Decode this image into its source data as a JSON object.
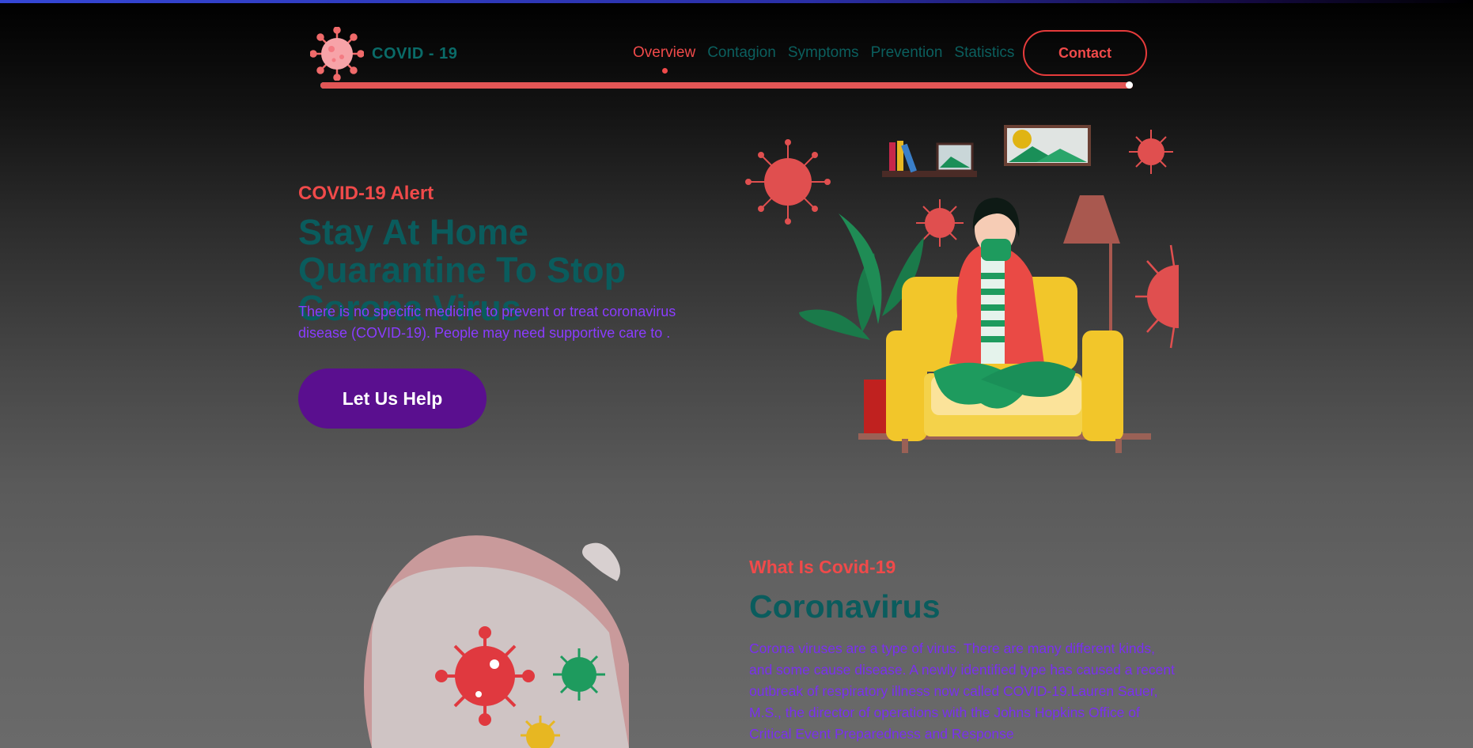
{
  "header": {
    "logo_text": "COVID - 19",
    "nav": [
      {
        "label": "Overview",
        "active": true
      },
      {
        "label": "Contagion",
        "active": false
      },
      {
        "label": "Symptoms",
        "active": false
      },
      {
        "label": "Prevention",
        "active": false
      },
      {
        "label": "Statistics",
        "active": false
      }
    ],
    "contact_label": "Contact",
    "scroll_progress": 1.0
  },
  "hero": {
    "alert": "COVID-19 Alert",
    "title": "Stay At Home Quarantine To Stop Corona Virus",
    "text": "There is no specific medicine to prevent or treat coronavirus disease (COVID-19). People may need supportive care to .",
    "button_label": "Let Us Help"
  },
  "about": {
    "label": "What Is Covid-19",
    "title": "Coronavirus",
    "text": "Corona viruses are a type of virus. There are many different kinds, and some cause disease. A newly identified type has caused a recent outbreak of respiratory illness now called COVID-19.Lauren Sauer, M.S., the director of operations with the Johns Hopkins Office of Critical Event Preparedness and Response"
  },
  "colors": {
    "accent_red": "#f04a4a",
    "teal": "#0a5c5d",
    "purple_text": "#8a3cff",
    "button_purple": "#5a0f8f"
  },
  "icons": [
    "virus-logo-icon",
    "virus-icon"
  ]
}
